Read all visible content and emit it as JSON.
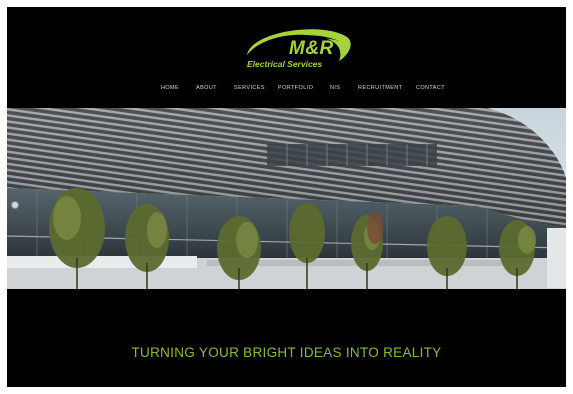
{
  "brand": {
    "name": "M&R",
    "subtitle": "Electrical Services",
    "accent_color": "#a6d23a",
    "icon": "swoosh-logo-icon"
  },
  "nav": {
    "items": [
      {
        "label": "HOME"
      },
      {
        "label": "ABOUT"
      },
      {
        "label": "SERVICES"
      },
      {
        "label": "PORTFOLIO"
      },
      {
        "label": "NIS"
      },
      {
        "label": "RECRUITMENT"
      },
      {
        "label": "CONTACT"
      }
    ]
  },
  "hero": {
    "image": "modern-building-photo",
    "slider_indicator": "slider-dot-icon"
  },
  "tagline": {
    "text": "TURNING YOUR BRIGHT IDEAS INTO REALITY",
    "color": "#8dbb2f"
  },
  "colors": {
    "background": "#000000",
    "frame": "#ffffff"
  }
}
